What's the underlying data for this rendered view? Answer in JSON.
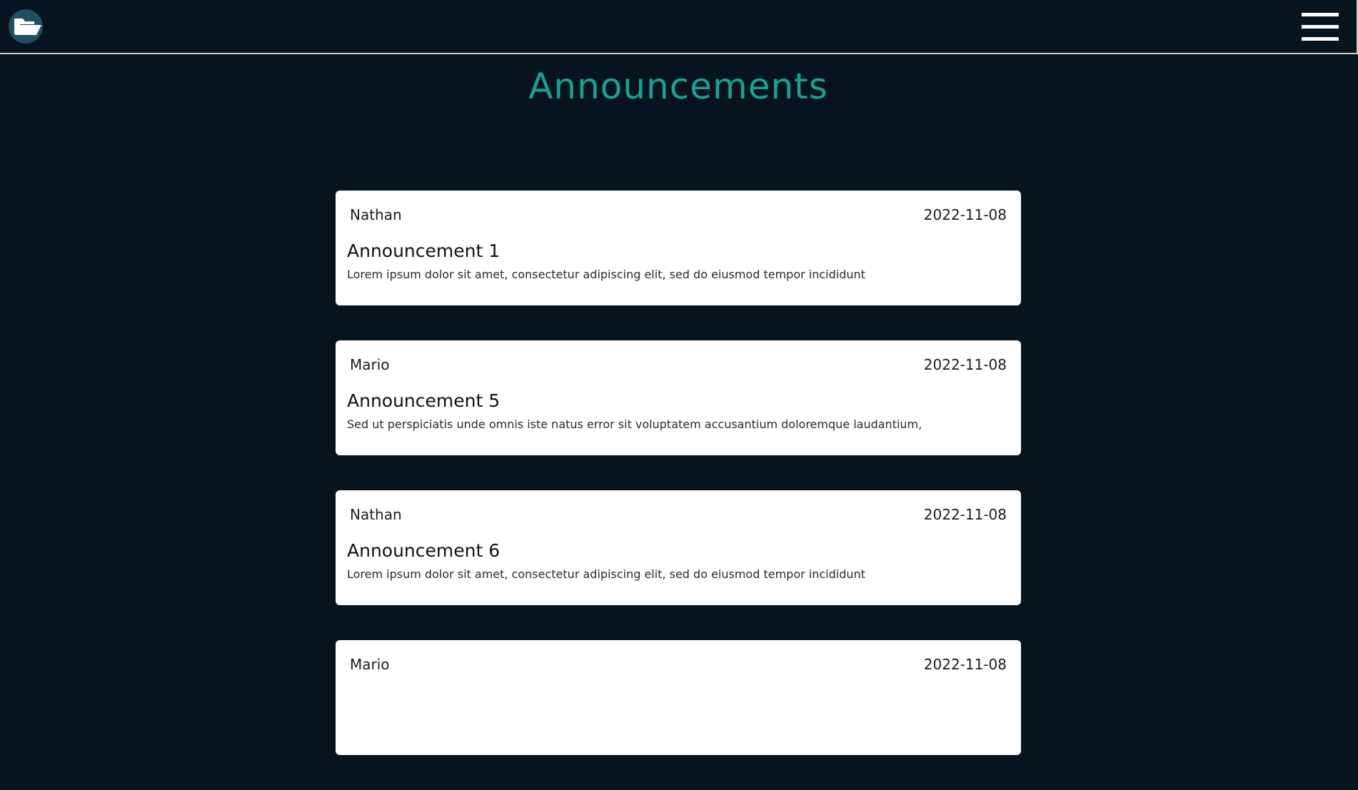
{
  "page": {
    "title": "Announcements"
  },
  "nav": {
    "logo_icon": "folder-icon",
    "menu_icon": "hamburger-menu-icon"
  },
  "colors": {
    "background": "#061420",
    "accent": "#1f9e93",
    "card": "#ffffff"
  },
  "announcements": [
    {
      "author": "Nathan",
      "date": "2022-11-08",
      "title": "Announcement 1",
      "body": "Lorem ipsum dolor sit amet, consectetur adipiscing elit, sed do eiusmod tempor incididunt"
    },
    {
      "author": "Mario",
      "date": "2022-11-08",
      "title": "Announcement 5",
      "body": "Sed ut perspiciatis unde omnis iste natus error sit voluptatem accusantium doloremque laudantium,"
    },
    {
      "author": "Nathan",
      "date": "2022-11-08",
      "title": "Announcement 6",
      "body": "Lorem ipsum dolor sit amet, consectetur adipiscing elit, sed do eiusmod tempor incididunt"
    },
    {
      "author": "Mario",
      "date": "2022-11-08",
      "title": "",
      "body": ""
    }
  ]
}
